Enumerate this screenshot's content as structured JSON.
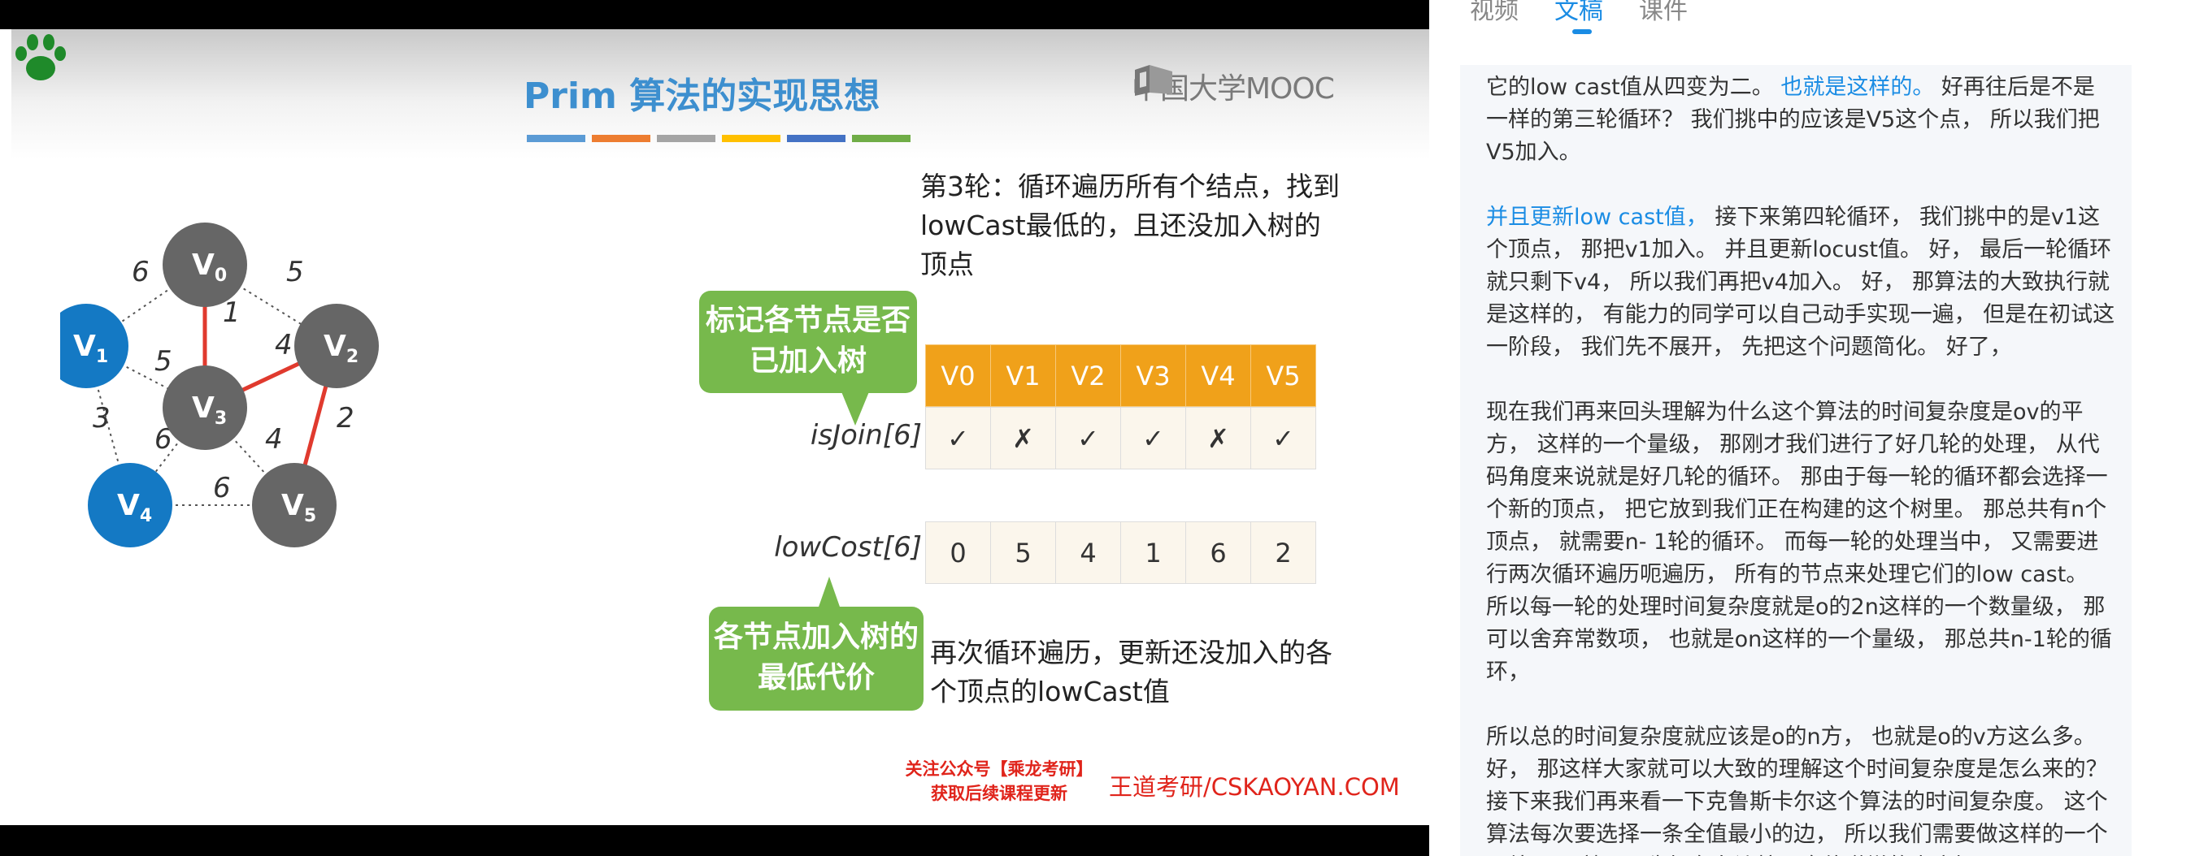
{
  "slide": {
    "title": "Prim 算法的实现思想",
    "logo": "中国大学MOOC",
    "title_bar_colors": [
      "#5b9bd5",
      "#ed7d31",
      "#a5a5a5",
      "#ffc000",
      "#4472c4",
      "#70ad47"
    ],
    "round_text": "第3轮：循环遍历所有个结点，找到lowCast最低的，且还没加入树的顶点",
    "callout_isjoin": "标记各节点是否已加入树",
    "callout_lowcost": "各节点加入树的最低代价",
    "label_isjoin": "isJoin[6]",
    "label_lowcost": "lowCost[6]",
    "headers": [
      "V0",
      "V1",
      "V2",
      "V3",
      "V4",
      "V5"
    ],
    "isjoin": [
      "✓",
      "✗",
      "✓",
      "✓",
      "✗",
      "✓"
    ],
    "lowcost": [
      "0",
      "5",
      "4",
      "1",
      "6",
      "2"
    ],
    "again_text": "再次循环遍历，更新还没加入的各个顶点的lowCast值",
    "promo_line1": "关注公众号【乘龙考研】",
    "promo_line2": "获取后续课程更新",
    "site": "王道考研/CSKAOYAN.COM",
    "graph": {
      "nodes": [
        {
          "id": "V0",
          "sub": "0",
          "in_tree": true
        },
        {
          "id": "V1",
          "sub": "1",
          "in_tree": false
        },
        {
          "id": "V2",
          "sub": "2",
          "in_tree": true
        },
        {
          "id": "V3",
          "sub": "3",
          "in_tree": true
        },
        {
          "id": "V4",
          "sub": "4",
          "in_tree": false
        },
        {
          "id": "V5",
          "sub": "5",
          "in_tree": true
        }
      ],
      "edges": [
        {
          "from": "V0",
          "to": "V1",
          "w": "6",
          "tree": false
        },
        {
          "from": "V0",
          "to": "V2",
          "w": "5",
          "tree": false
        },
        {
          "from": "V0",
          "to": "V3",
          "w": "1",
          "tree": true
        },
        {
          "from": "V1",
          "to": "V3",
          "w": "5",
          "tree": false
        },
        {
          "from": "V3",
          "to": "V2",
          "w": "4",
          "tree": true
        },
        {
          "from": "V1",
          "to": "V4",
          "w": "3",
          "tree": false
        },
        {
          "from": "V3",
          "to": "V4",
          "w": "6",
          "tree": false
        },
        {
          "from": "V3",
          "to": "V5",
          "w": "4",
          "tree": false
        },
        {
          "from": "V2",
          "to": "V5",
          "w": "2",
          "tree": true
        },
        {
          "from": "V4",
          "to": "V5",
          "w": "6",
          "tree": false
        }
      ],
      "colors": {
        "in_tree": "#666666",
        "not_in_tree": "#1479c4",
        "tree_edge": "#e03a2e",
        "other_edge": "#555555"
      }
    }
  },
  "panel": {
    "tabs": [
      {
        "label": "视频",
        "active": false
      },
      {
        "label": "文稿",
        "active": true
      },
      {
        "label": "课件",
        "active": false
      }
    ],
    "p1_a": "它的low cast值从四变为二。",
    "p1_hl": "也就是这样的。",
    "p1_b": "好再往后是不是一样的第三轮循环？ 我们挑中的应该是V5这个点， 所以我们把V5加入。",
    "p2_hl": "并且更新low cast值，",
    "p2_b": " 接下来第四轮循环， 我们挑中的是v1这个顶点， 那把v1加入。 并且更新locust值。 好， 最后一轮循环就只剩下v4， 所以我们再把v4加入。 好， 那算法的大致执行就是这样的， 有能力的同学可以自己动手实现一遍， 但是在初试这一阶段， 我们先不展开， 先把这个问题简化。 好了，",
    "p3": "现在我们再来回头理解为什么这个算法的时间复杂度是ov的平方， 这样的一个量级， 那刚才我们进行了好几轮的处理， 从代码角度来说就是好几轮的循环。 那由于每一轮的循环都会选择一个新的顶点， 把它放到我们正在构建的这个树里。 那总共有n个顶点， 就需要n- 1轮的循环。 而每一轮的处理当中， 又需要进行两次循环遍历呃遍历， 所有的节点来处理它们的low cast。 所以每一轮的处理时间复杂度就是o的2n这样的一个数量级， 那可以舍弃常数项， 也就是on这样的一个量级， 那总共n-1轮的循环，",
    "p4": "所以总的时间复杂度就应该是o的n方， 也就是o的v方这么多。 好， 那这样大家就可以大致的理解这个时间复杂度是怎么来的？ 接下来我们再来看一下克鲁斯卡尔这个算法的时间复杂度。 这个算法每次要选择一条全值最小的边， 所以我们需要做这样的一个预处理， 就是要先把各条边按照全值递增的次序把"
  }
}
